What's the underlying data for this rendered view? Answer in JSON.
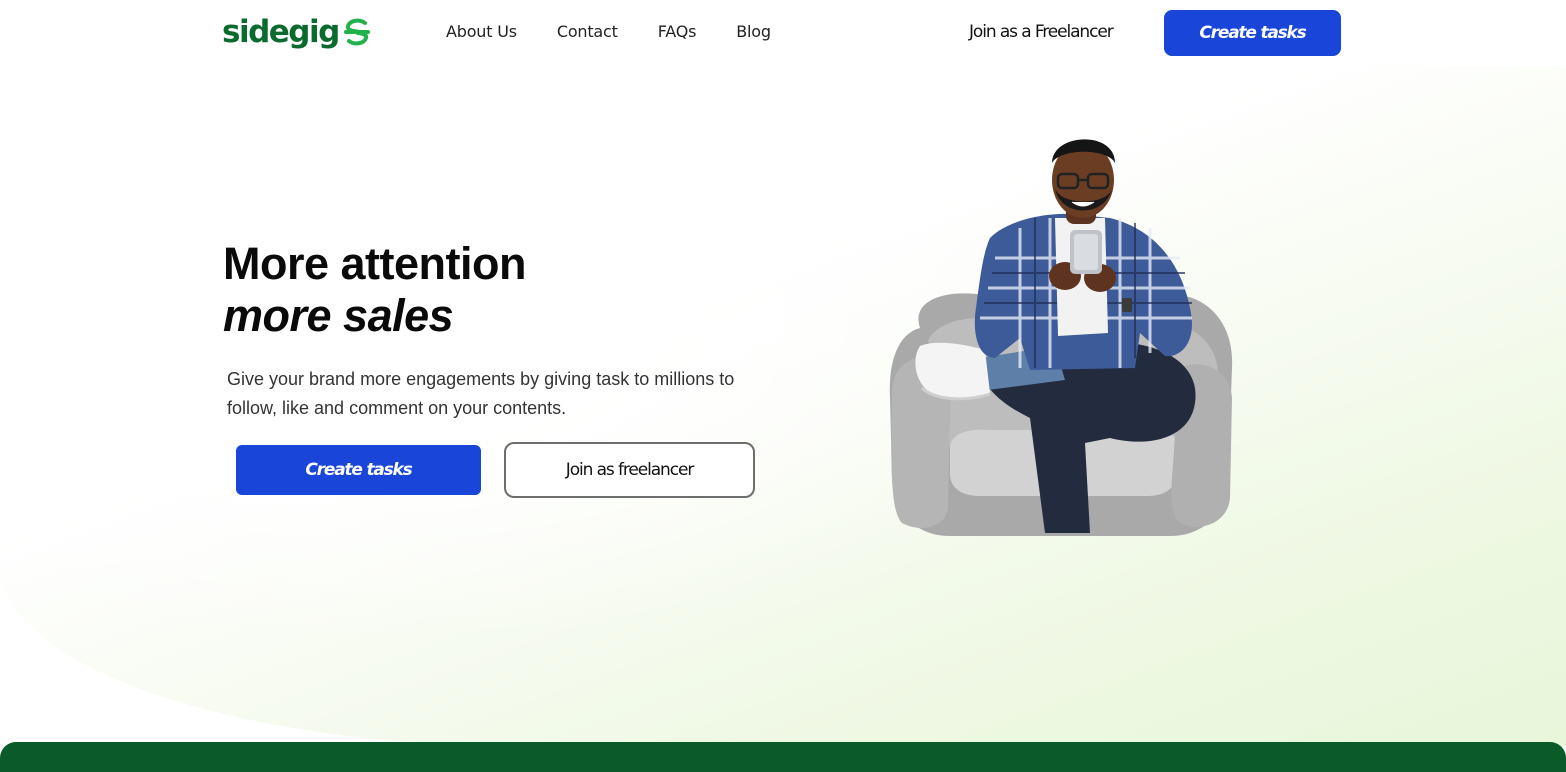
{
  "brand": {
    "name": "sidegig",
    "color": "#0b6b2e",
    "logo_icon": "sidegig-swirl-icon"
  },
  "nav": {
    "items": [
      {
        "label": "About Us"
      },
      {
        "label": "Contact"
      },
      {
        "label": "FAQs"
      },
      {
        "label": "Blog"
      }
    ],
    "join_label": "Join as a Freelancer",
    "cta_label": "Create tasks"
  },
  "hero": {
    "title_line1": "More attention",
    "title_line2": "more sales",
    "description": "Give your brand more engagements by giving task to millions to follow, like and comment on your contents.",
    "primary_button": "Create tasks",
    "secondary_button": "Join as freelancer",
    "illustration": "man-on-armchair-with-phone"
  },
  "colors": {
    "primary": "#1946d8",
    "accent_green": "#0b5a2a",
    "hero_tint": "#e8f6da"
  }
}
